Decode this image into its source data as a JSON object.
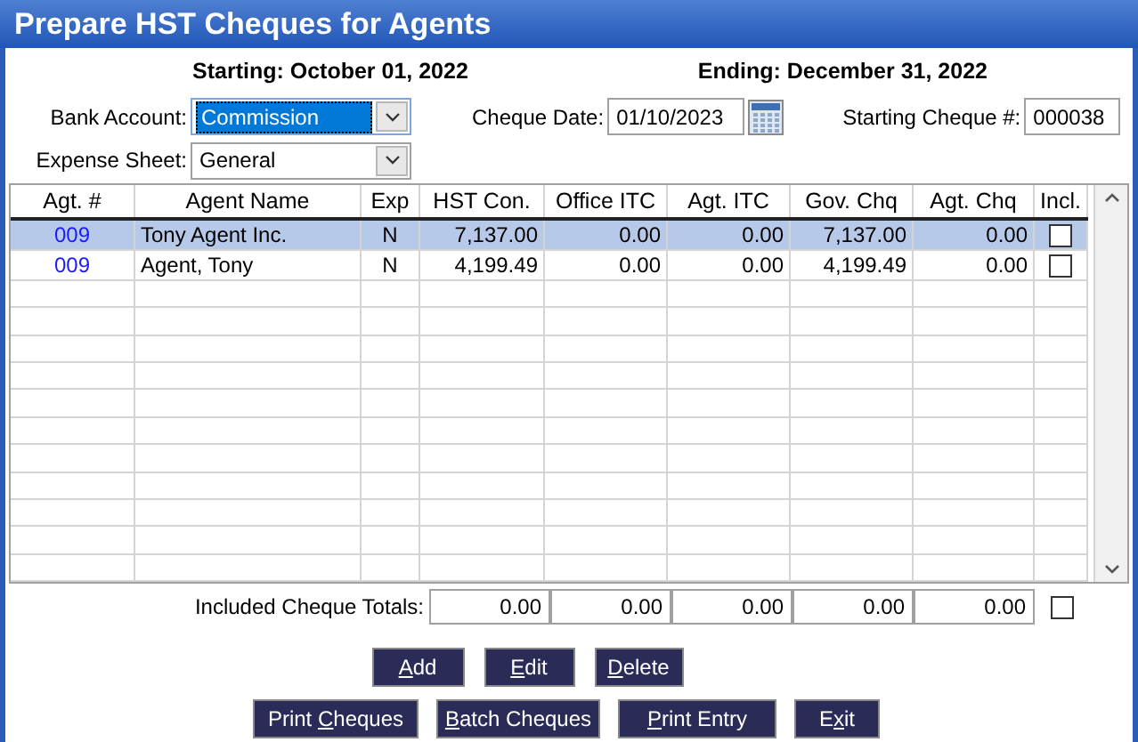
{
  "window": {
    "title": "Prepare HST Cheques for Agents"
  },
  "period": {
    "starting": "Starting: October 01, 2022",
    "ending": "Ending: December 31, 2022"
  },
  "bank_account": {
    "label": "Bank Account:",
    "value": "Commission",
    "focused": true
  },
  "cheque_date": {
    "label": "Cheque Date:",
    "value": "01/10/2023"
  },
  "starting_cheque": {
    "label": "Starting Cheque #:",
    "value": "000038"
  },
  "expense_sheet": {
    "label": "Expense Sheet:",
    "value": "General",
    "focused": false
  },
  "table": {
    "columns": [
      "Agt. #",
      "Agent Name",
      "Exp",
      "HST Con.",
      "Office ITC",
      "Agt. ITC",
      "Gov. Chq",
      "Agt. Chq",
      "Incl."
    ],
    "rows": [
      {
        "agent_no": "009",
        "agent_name": "Tony Agent Inc.",
        "exp": "N",
        "hst_con": "7,137.00",
        "office_itc": "0.00",
        "agt_itc": "0.00",
        "gov_chq": "7,137.00",
        "agt_chq": "0.00",
        "included": false,
        "selected": true
      },
      {
        "agent_no": "009",
        "agent_name": "Agent, Tony",
        "exp": "N",
        "hst_con": "4,199.49",
        "office_itc": "0.00",
        "agt_itc": "0.00",
        "gov_chq": "4,199.49",
        "agt_chq": "0.00",
        "included": false,
        "selected": false
      }
    ]
  },
  "totals": {
    "label": "Included Cheque Totals:",
    "values": [
      "0.00",
      "0.00",
      "0.00",
      "0.00",
      "0.00"
    ],
    "included": false
  },
  "button_rows": [
    [
      {
        "key": "A",
        "after": "dd"
      },
      {
        "key": "E",
        "after": "dit"
      },
      {
        "key": "D",
        "after": "elete"
      }
    ],
    [
      {
        "before": "Print ",
        "key": "C",
        "after": "heques"
      },
      {
        "key": "B",
        "after": "atch Cheques"
      },
      {
        "key": "P",
        "after": "rint Entry"
      },
      {
        "before": "E",
        "key": "x",
        "after": "it"
      }
    ]
  ]
}
